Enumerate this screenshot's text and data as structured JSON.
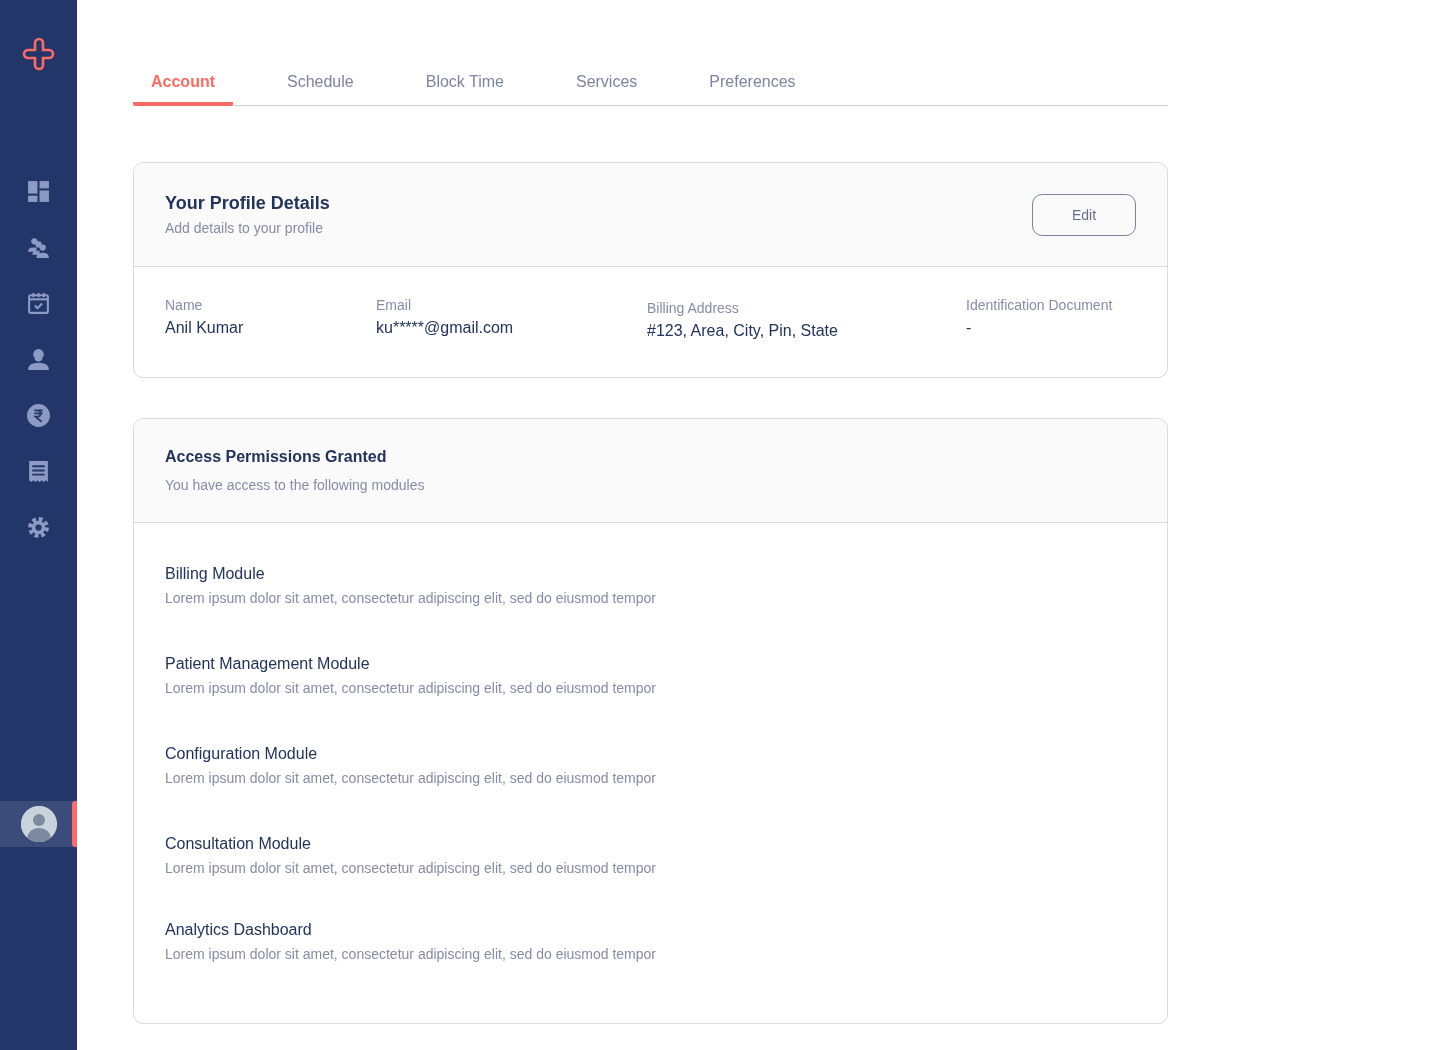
{
  "sidebar": {
    "nav_items": [
      {
        "selected": false
      },
      {
        "selected": false
      },
      {
        "selected": false
      },
      {
        "selected": false
      },
      {
        "selected": false
      },
      {
        "selected": false
      },
      {
        "selected": false
      }
    ],
    "profile": {
      "selected": true
    }
  },
  "tabs": [
    {
      "label": "Account",
      "selected": true
    },
    {
      "label": "Schedule",
      "selected": false
    },
    {
      "label": "Block Time",
      "selected": false
    },
    {
      "label": "Services",
      "selected": false
    },
    {
      "label": "Preferences",
      "selected": false
    }
  ],
  "profile_card": {
    "title": "Your Profile Details",
    "subtitle": "Add details to your profile",
    "edit_button": "Edit",
    "fields": [
      {
        "label": "Name",
        "value": "Anil Kumar"
      },
      {
        "label": "Email",
        "value": "ku*****@gmail.com"
      },
      {
        "label": "Billing Address",
        "value": "#123, Area, City, Pin, State"
      },
      {
        "label": "Identification Document",
        "value": "-"
      }
    ]
  },
  "permissions_card": {
    "title": "Access Permissions Granted",
    "subtitle": "You have access to the following modules",
    "modules": [
      {
        "name": "Billing Module",
        "description": "Lorem ipsum dolor sit amet, consectetur adipiscing elit, sed do eiusmod tempor"
      },
      {
        "name": "Patient Management Module",
        "description": "Lorem ipsum dolor sit amet, consectetur adipiscing elit, sed do eiusmod tempor"
      },
      {
        "name": "Configuration Module",
        "description": "Lorem ipsum dolor sit amet, consectetur adipiscing elit, sed do eiusmod tempor"
      },
      {
        "name": "Consultation Module",
        "description": "Lorem ipsum dolor sit amet, consectetur adipiscing elit, sed do eiusmod tempor"
      },
      {
        "name": "Analytics Dashboard",
        "description": "Lorem ipsum dolor sit amet, consectetur adipiscing elit, sed do eiusmod tempor"
      }
    ]
  }
}
